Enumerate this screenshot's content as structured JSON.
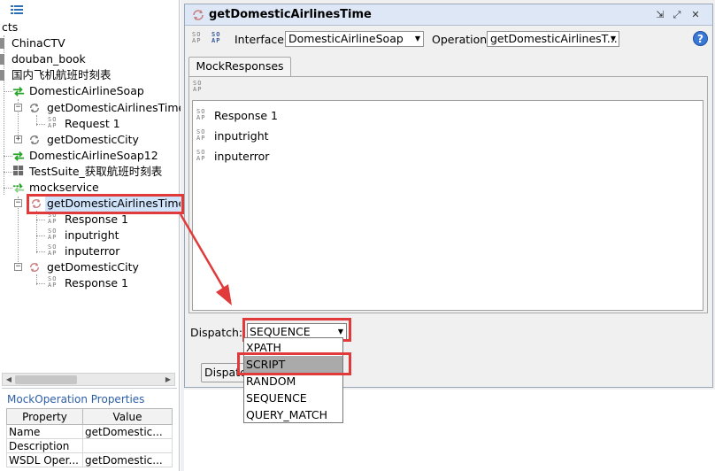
{
  "navigator": {
    "root_label": "cts",
    "items": [
      {
        "label": "ChinaCTV"
      },
      {
        "label": "douban_book"
      },
      {
        "label": "国内飞机航班时刻表"
      },
      {
        "label": "DomesticAirlineSoap"
      },
      {
        "label": "getDomesticAirlinesTime"
      },
      {
        "label": "Request 1"
      },
      {
        "label": "getDomesticCity"
      },
      {
        "label": "DomesticAirlineSoap12"
      },
      {
        "label": "TestSuite_获取航班时刻表"
      },
      {
        "label": "mockservice"
      },
      {
        "label": "getDomesticAirlinesTime"
      },
      {
        "label": "Response 1"
      },
      {
        "label": "inputright"
      },
      {
        "label": "inputerror"
      },
      {
        "label": "getDomesticCity"
      },
      {
        "label": "Response 1"
      }
    ],
    "soap_icon_text": "SO AP"
  },
  "properties": {
    "title": "MockOperation Properties",
    "columns": [
      "Property",
      "Value"
    ],
    "rows": [
      {
        "property": "Name",
        "value": "getDomestic..."
      },
      {
        "property": "Description",
        "value": ""
      },
      {
        "property": "WSDL Oper...",
        "value": "getDomestic..."
      }
    ]
  },
  "editor": {
    "title": "getDomesticAirlinesTime",
    "interface_label": "Interface",
    "interface_value": "DomesticAirlineSoap",
    "operation_label": "Operation",
    "operation_value": "getDomesticAirlinesT...",
    "help_glyph": "?",
    "tab_label": "MockResponses",
    "responses": [
      "Response 1",
      "inputright",
      "inputerror"
    ],
    "dispatch_label": "Dispatch:",
    "dispatch_value": "SEQUENCE",
    "dispatch_button": "Dispatch",
    "dispatch_options": [
      {
        "label": "XPATH",
        "highlighted": false
      },
      {
        "label": "SCRIPT",
        "highlighted": true
      },
      {
        "label": "RANDOM",
        "highlighted": false
      },
      {
        "label": "SEQUENCE",
        "highlighted": false
      },
      {
        "label": "QUERY_MATCH",
        "highlighted": false
      }
    ]
  },
  "colors": {
    "annotation_red": "#e03a3a",
    "mock_green": "#2aa52a",
    "help_blue": "#3a78d4"
  }
}
